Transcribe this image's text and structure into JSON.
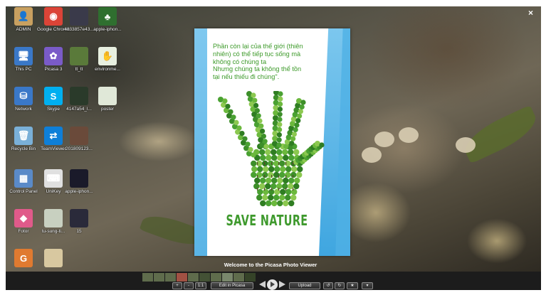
{
  "desktop": {
    "icons": [
      {
        "label": "ADMIN",
        "glyph": "👤",
        "color": "#c8a060"
      },
      {
        "label": "Google Chrome",
        "glyph": "◉",
        "color": "#db4437"
      },
      {
        "label": "4833857e43...",
        "glyph": "",
        "color": "#3a3a4a"
      },
      {
        "label": "apple-iphon...",
        "glyph": "♣",
        "color": "#2f6f2f"
      },
      {
        "label": "This PC",
        "glyph": "🖥",
        "color": "#3a78c8"
      },
      {
        "label": "Picasa 3",
        "glyph": "✿",
        "color": "#7a5bc8"
      },
      {
        "label": "tt_tt",
        "glyph": "",
        "color": "#5a7a3a"
      },
      {
        "label": "environme...",
        "glyph": "✋",
        "color": "#e8f0e0"
      },
      {
        "label": "Network",
        "glyph": "⛁",
        "color": "#3a78c8"
      },
      {
        "label": "Skype",
        "glyph": "S",
        "color": "#00aff0"
      },
      {
        "label": "4147a54_l...",
        "glyph": "",
        "color": "#2a3a2a"
      },
      {
        "label": "poster",
        "glyph": "",
        "color": "#e0e8d8"
      },
      {
        "label": "Recycle Bin",
        "glyph": "🗑",
        "color": "#7ab0d8"
      },
      {
        "label": "TeamViewer",
        "glyph": "⇄",
        "color": "#0e7fd8"
      },
      {
        "label": "201809123...",
        "glyph": "",
        "color": "#6a4a3a"
      },
      {
        "label": "Control Panel",
        "glyph": "▦",
        "color": "#5a8ac8"
      },
      {
        "label": "UniKey",
        "glyph": "⌨",
        "color": "#e0e0e0"
      },
      {
        "label": "apple-iphon...",
        "glyph": "",
        "color": "#1a1a2a"
      },
      {
        "label": "Fotor",
        "glyph": "◆",
        "color": "#e05a8a"
      },
      {
        "label": "tu-sung-ti...",
        "glyph": "",
        "color": "#c8d0c0"
      },
      {
        "label": "15",
        "glyph": "",
        "color": "#2a2a3a"
      },
      {
        "label": "",
        "glyph": "G",
        "color": "#e07a30"
      },
      {
        "label": "",
        "glyph": "",
        "color": "#d8c8a0"
      }
    ]
  },
  "viewer": {
    "close_icon": "×",
    "welcome": "Welcome to the Picasa Photo Viewer",
    "photo": {
      "quote_lines": [
        "Phần còn lại của thế giới (thiên",
        "nhiên) có thể tiếp tục sống mà",
        "không có chúng ta",
        "Nhưng chúng ta không thể tồn",
        "tại nếu thiếu đi chúng\"."
      ],
      "title": "SAVE NATURE",
      "accent_color": "#3f9a2e"
    },
    "toolbar": {
      "zoom_in": "+",
      "zoom_out": "-",
      "actual_size": "1:1",
      "edit": "Edit in Picasa",
      "upload": "Upload",
      "rotate_left": "↺",
      "rotate_right": "↻",
      "star": "★",
      "more": "▾"
    }
  }
}
